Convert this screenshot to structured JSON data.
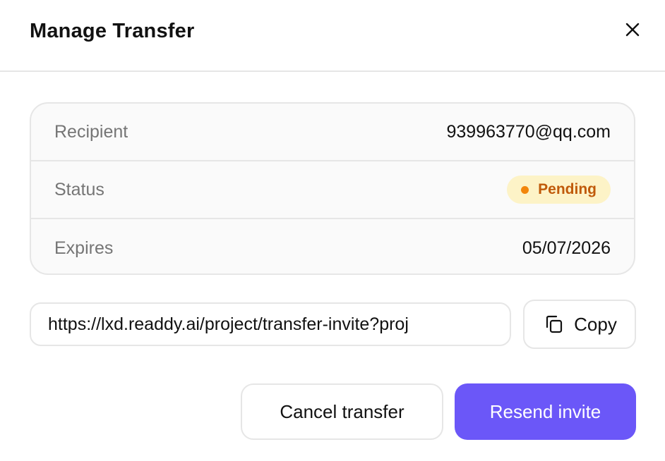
{
  "dialog": {
    "title": "Manage Transfer",
    "close_icon": "close-icon"
  },
  "details": {
    "recipient_label": "Recipient",
    "recipient_value": "939963770@qq.com",
    "status_label": "Status",
    "status_value": "Pending",
    "status_color": "#f2860c",
    "status_text_color": "#c05a0a",
    "status_bg_color": "#fdf3c7",
    "expires_label": "Expires",
    "expires_value": "05/07/2026"
  },
  "link": {
    "value": "https://lxd.readdy.ai/project/transfer-invite?proj",
    "copy_label": "Copy",
    "copy_icon": "copy-icon"
  },
  "actions": {
    "cancel_label": "Cancel transfer",
    "resend_label": "Resend invite",
    "accent_color": "#6b57f8"
  }
}
